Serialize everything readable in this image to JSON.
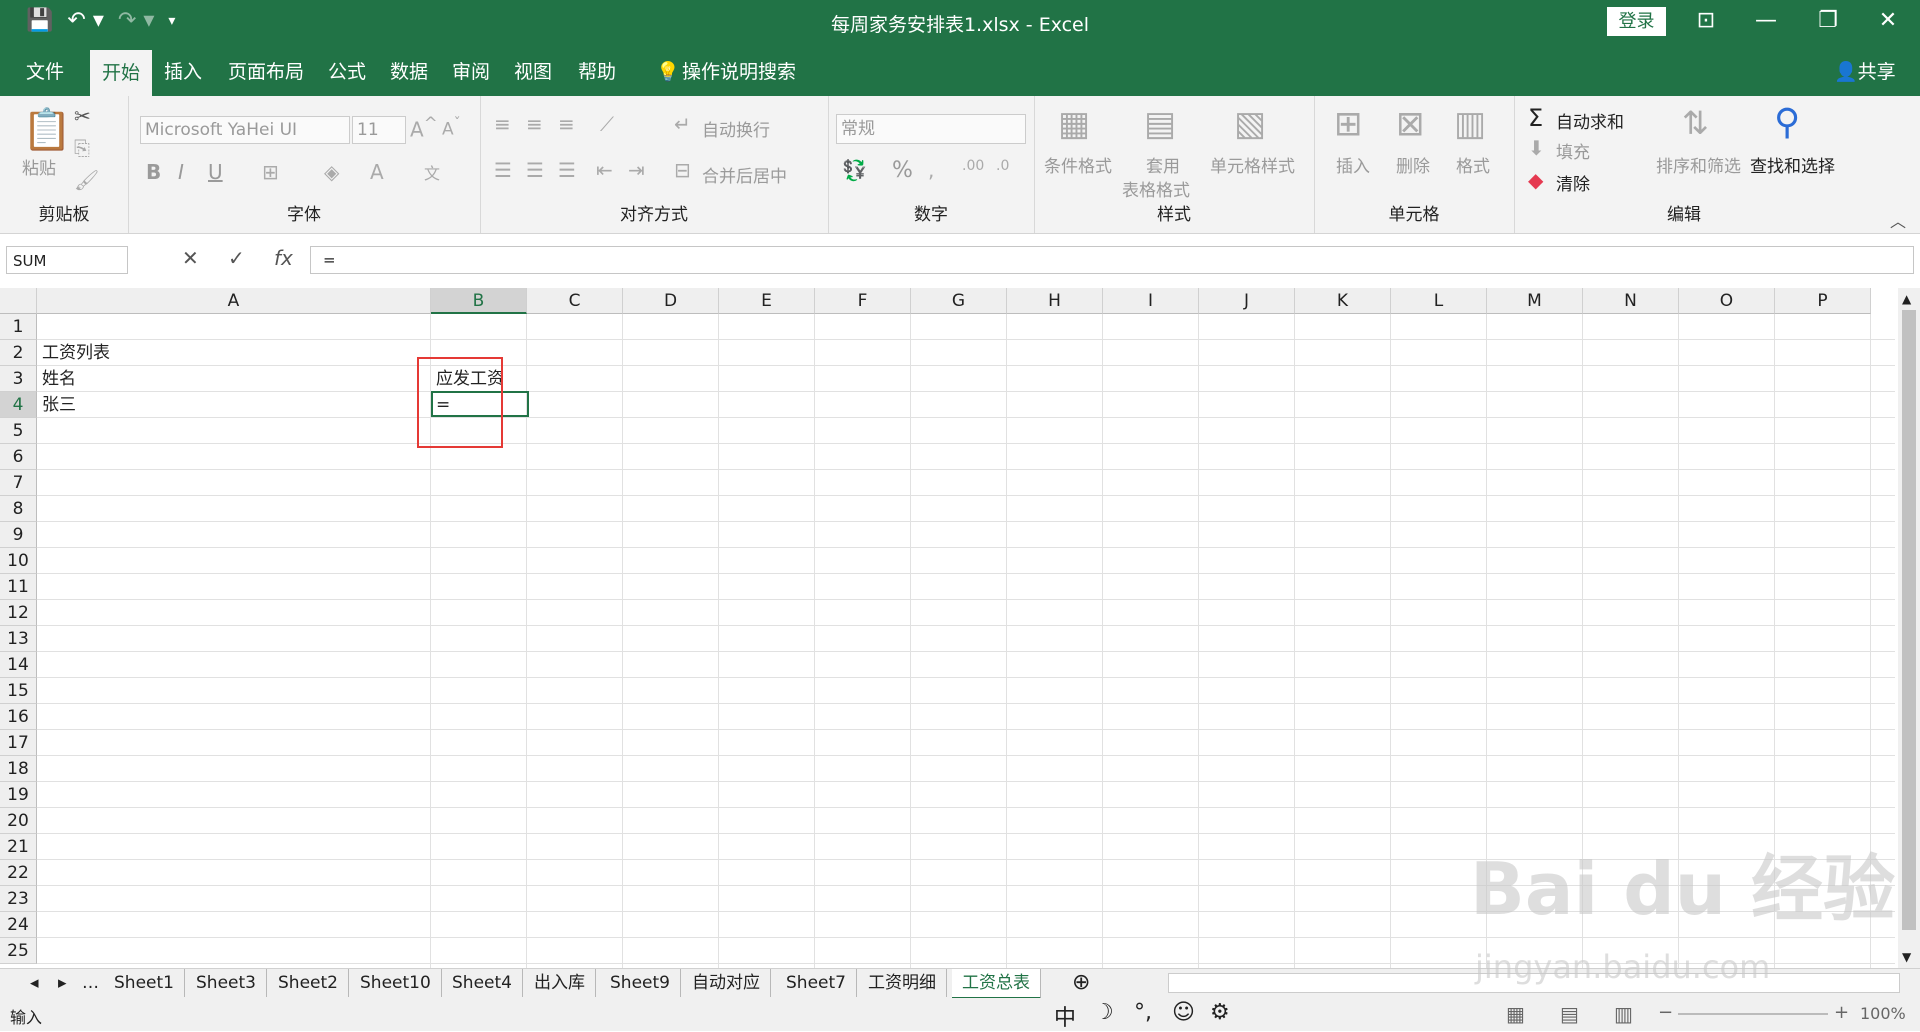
{
  "window": {
    "title": "每周家务安排表1.xlsx  -  Excel",
    "login": "登录"
  },
  "tabs": [
    "文件",
    "开始",
    "插入",
    "页面布局",
    "公式",
    "数据",
    "审阅",
    "视图",
    "帮助",
    "操作说明搜索"
  ],
  "share": "共享",
  "ribbon": {
    "clipboard": {
      "label": "剪贴板",
      "paste": "粘贴"
    },
    "font": {
      "label": "字体",
      "name": "Microsoft YaHei UI",
      "size": "11",
      "bold": "B",
      "italic": "I",
      "underline": "U"
    },
    "align": {
      "label": "对齐方式",
      "wrap": "自动换行",
      "merge": "合并后居中"
    },
    "number": {
      "label": "数字",
      "format": "常规",
      "percent": "%"
    },
    "styles": {
      "label": "样式",
      "cond": "条件格式",
      "table1": "套用",
      "table2": "表格格式",
      "cell": "单元格样式"
    },
    "cells": {
      "label": "单元格",
      "insert": "插入",
      "delete": "删除",
      "format": "格式"
    },
    "edit": {
      "label": "编辑",
      "autosum": "自动求和",
      "fill": "填充",
      "clear": "清除",
      "sort": "排序和筛选",
      "find": "查找和选择"
    }
  },
  "formula": {
    "namebox": "SUM",
    "content": "="
  },
  "columns": [
    "A",
    "B",
    "C",
    "D",
    "E",
    "F",
    "G",
    "H",
    "I",
    "J",
    "K",
    "L",
    "M",
    "N",
    "O",
    "P"
  ],
  "rows": [
    "1",
    "2",
    "3",
    "4",
    "5",
    "6",
    "7",
    "8",
    "9",
    "10",
    "11",
    "12",
    "13",
    "14",
    "15",
    "16",
    "17",
    "18",
    "19",
    "20",
    "21",
    "22",
    "23",
    "24",
    "25"
  ],
  "cells": {
    "A2": "工资列表",
    "A3": "姓名",
    "B3": "应发工资",
    "A4": "张三",
    "B4": "="
  },
  "sheets": [
    "Sheet1",
    "Sheet3",
    "Sheet2",
    "Sheet10",
    "Sheet4",
    "出入库",
    "Sheet9",
    "自动对应",
    "Sheet7",
    "工资明细",
    "工资总表"
  ],
  "status": {
    "mode": "输入",
    "zoom": "100%",
    "ime": "中"
  },
  "watermark": {
    "brand": "Bai du 经验",
    "url": "jingyan.baidu.com"
  }
}
